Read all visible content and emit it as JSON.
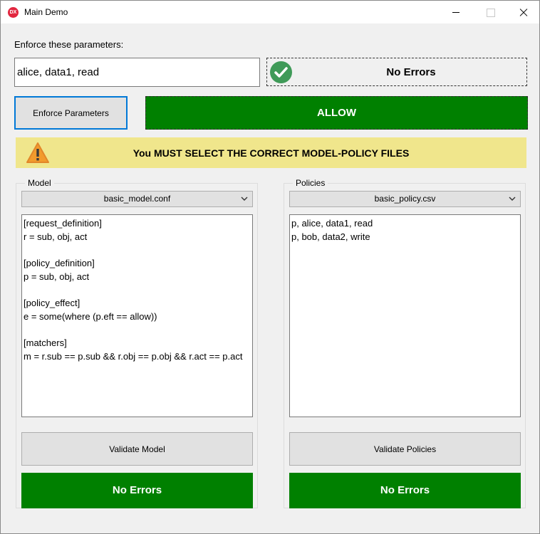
{
  "window": {
    "title": "Main Demo",
    "icon_text": "DX"
  },
  "enforce": {
    "label": "Enforce these parameters:",
    "input_value": "alice, data1, read",
    "status_text": "No Errors",
    "button_label": "Enforce Parameters",
    "result_text": "ALLOW"
  },
  "warning": {
    "text": "You MUST SELECT THE CORRECT MODEL-POLICY FILES"
  },
  "model": {
    "group_label": "Model",
    "selected_file": "basic_model.conf",
    "content": "[request_definition]\nr = sub, obj, act\n\n[policy_definition]\np = sub, obj, act\n\n[policy_effect]\ne = some(where (p.eft == allow))\n\n[matchers]\nm = r.sub == p.sub && r.obj == p.obj && r.act == p.act",
    "validate_label": "Validate Model",
    "result_text": "No Errors"
  },
  "policies": {
    "group_label": "Policies",
    "selected_file": "basic_policy.csv",
    "content": "p, alice, data1, read\np, bob, data2, write",
    "validate_label": "Validate Policies",
    "result_text": "No Errors"
  },
  "colors": {
    "success_green": "#008000",
    "warning_yellow": "#f0e68c",
    "focus_blue": "#0078d7",
    "check_green": "#3f9a58"
  },
  "icons": {
    "app": "app-logo-icon",
    "status": "check-circle-icon",
    "warning": "warning-triangle-icon",
    "dropdown": "chevron-down-icon"
  }
}
